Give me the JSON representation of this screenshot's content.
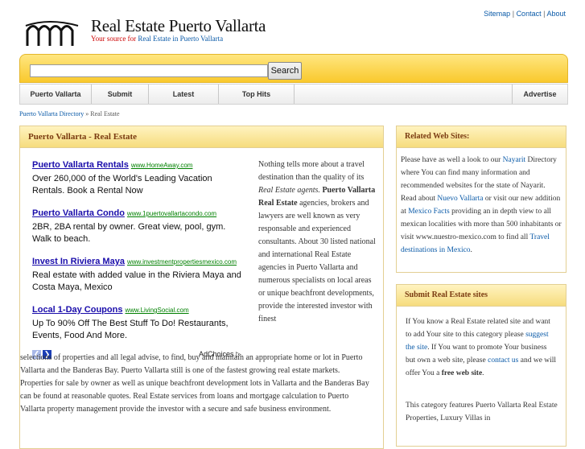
{
  "top_links": {
    "sitemap": "Sitemap",
    "contact": "Contact",
    "about": "About",
    "sep": "|"
  },
  "header": {
    "title": "Real Estate Puerto Vallarta",
    "tagline_prefix": "Your source for",
    "tagline_link": "Real Estate in Puerto Vallarta"
  },
  "search": {
    "placeholder": "",
    "button": "Search"
  },
  "nav": [
    "Puerto Vallarta",
    "Submit",
    "Latest",
    "Top Hits",
    "Advertise"
  ],
  "breadcrumb": {
    "home": "Puerto Vallarta Directory",
    "sep": "»",
    "current": "Real Estate"
  },
  "main": {
    "heading": "Puerto Vallarta - Real Estate",
    "ads": [
      {
        "title": "Puerto Vallarta Rentals",
        "url": "www.HomeAway.com",
        "desc": "Over 260,000 of the World's Leading Vacation Rentals. Book a Rental Now"
      },
      {
        "title": "Puerto Vallarta Condo",
        "url": "www.1puertovallartacondo.com",
        "desc": "2BR, 2BA rental by owner. Great view, pool, gym. Walk to beach."
      },
      {
        "title": "Invest In Riviera Maya",
        "url": "www.investmentpropertiesmexico.com",
        "desc": "Real estate with added value in the Riviera Maya and Costa Maya, Mexico"
      },
      {
        "title": "Local 1-Day Coupons",
        "url": "www.LivingSocial.com",
        "desc": "Up To 90% Off The Best Stuff To Do! Restaurants, Events, Food And More."
      }
    ],
    "adchoices": "AdChoices ▷",
    "article": {
      "p1": "Nothing tells more about a travel destination than the quality of its",
      "p1_em": "Real Estate agents.",
      "p1_bold": "Puerto Vallarta Real Estate",
      "p1_rest": "agencies, brokers and lawyers are well known as very responsable and experienced consultants. About 30 listed national and international Real Estate agencies in Puerto Vallarta and numerous specialists on local areas or unique beachfront developments, provide the interested investor with finest",
      "p2": "selections of properties and all legal advise, to find, buy and maintain an appropriate home or lot in Puerto Vallarta and the Banderas Bay. Puerto Vallarta still is one of the fastest growing real estate markets. Properties for sale by owner as well as unique beachfront development lots in Vallarta and the Banderas Bay can be found at reasonable quotes. Real Estate services from loans and mortgage calculation to Puerto Vallarta property management provide the investor with a secure and safe business environment."
    }
  },
  "related": {
    "heading": "Related Web Sites:",
    "t1": "Please have as well a look to our",
    "l1": "Nayarit",
    "t2": "Directory where You can find many information and recommended websites for the state of Nayarit. Read about",
    "l2": "Nuevo Vallarta",
    "t3": "or visit our new addition at",
    "l3": "Mexico Facts",
    "t4": "providing an in depth view to all mexican localities with more than 500 inhabitants or visit www.nuestro-mexico.com to find all",
    "l4": "Travel destinations in Mexico",
    "t5": "."
  },
  "submit": {
    "heading": "Submit Real Estate sites",
    "t1": "If You know a Real Estate related site and want to add Your site to this category please",
    "l1": "suggest the site",
    "t2": ". If You want to promote Your business but own a web site, please",
    "l2": "contact us",
    "t3": "and we will offer You a",
    "b1": "free web site",
    "t4": ".",
    "p2": "This category features Puerto Vallarta Real Estate Properties, Luxury Villas in"
  }
}
